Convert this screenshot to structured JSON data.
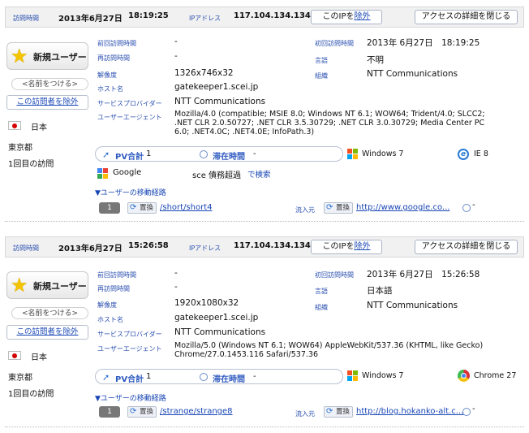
{
  "labels": {
    "visit_time": "訪問時間",
    "ip_address": "IPアドレス",
    "prev_visit": "前回訪問時間",
    "revisit": "再訪問時間",
    "resolution": "解像度",
    "host": "ホスト名",
    "provider": "サービスプロバイダー",
    "ua": "ユーザーエージェント",
    "first_visit": "初回訪問時間",
    "language": "言語",
    "org": "組織",
    "pv_total": "PV合計",
    "stay_time": "滞在時間",
    "route": "▼ユーザーの移動経路",
    "inflow": "流入元"
  },
  "buttons": {
    "exclude_ip_prefix": "このIPを",
    "exclude_ip_link": "除外",
    "close_details": "アクセスの詳細を閉じる",
    "new_user": "新規ユーザー",
    "name_it": "<名前をつける>",
    "exclude_visitor": "この訪問者を除外",
    "replace": "置換"
  },
  "visits": [
    {
      "date": "2013年6月27日",
      "time": "18:19:25",
      "ip": "117.104.134.134",
      "prev": "-",
      "revisit": "-",
      "resolution": "1326x746x32",
      "host": "gatekeeper1.scei.jp",
      "provider": "NTT Communications",
      "ua_lines": [
        "Mozilla/4.0 (compatible; MSIE 8.0; Windows NT 6.1; WOW64; Trident/4.0; SLCC2;",
        ".NET CLR 2.0.50727; .NET CLR 3.5.30729; .NET CLR 3.0.30729; Media Center PC",
        "6.0; .NET4.0C; .NET4.0E; InfoPath.3)"
      ],
      "first": "2013年 6月27日　18:19:25",
      "language": "不明",
      "org": "NTT Communications",
      "country": "日本",
      "region": "東京都",
      "visits_count": "1回目の訪問",
      "pv": "1",
      "stay": "-",
      "os": "Windows 7",
      "browser": "IE 8",
      "search_engine": "Google",
      "search_query": "sce 債務超過",
      "search_suffix": "で検索",
      "step": "1",
      "path": "/short/short4",
      "referrer": "http://www.google.co...",
      "ref_suffix": "-"
    },
    {
      "date": "2013年6月27日",
      "time": "15:26:58",
      "ip": "117.104.134.134",
      "prev": "-",
      "revisit": "-",
      "resolution": "1920x1080x32",
      "host": "gatekeeper1.scei.jp",
      "provider": "NTT Communications",
      "ua_lines": [
        "Mozilla/5.0 (Windows NT 6.1; WOW64) AppleWebKit/537.36 (KHTML, like Gecko)",
        "Chrome/27.0.1453.116 Safari/537.36"
      ],
      "first": "2013年 6月27日　15:26:58",
      "language": "日本語",
      "org": "NTT Communications",
      "country": "日本",
      "region": "東京都",
      "visits_count": "1回目の訪問",
      "pv": "1",
      "stay": "-",
      "os": "Windows 7",
      "browser": "Chrome 27",
      "step": "1",
      "path": "/strange/strange8",
      "referrer": "http://blog.hokanko-alt.c...",
      "ref_suffix": "-"
    }
  ],
  "colors": {
    "label_blue": "#2a4fb0",
    "link_blue": "#1846b5",
    "header_bg": "#f1f1f1"
  }
}
